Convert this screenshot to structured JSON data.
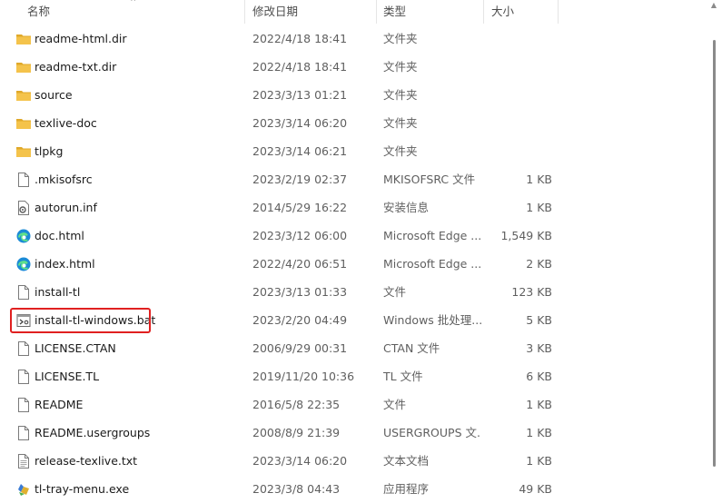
{
  "columns": {
    "name": "名称",
    "date": "修改日期",
    "type": "类型",
    "size": "大小"
  },
  "files": [
    {
      "name": "readme-html.dir",
      "date": "2022/4/18 18:41",
      "type": "文件夹",
      "size": "",
      "icon": "folder-icon"
    },
    {
      "name": "readme-txt.dir",
      "date": "2022/4/18 18:41",
      "type": "文件夹",
      "size": "",
      "icon": "folder-icon"
    },
    {
      "name": "source",
      "date": "2023/3/13 01:21",
      "type": "文件夹",
      "size": "",
      "icon": "folder-icon"
    },
    {
      "name": "texlive-doc",
      "date": "2023/3/14 06:20",
      "type": "文件夹",
      "size": "",
      "icon": "folder-icon"
    },
    {
      "name": "tlpkg",
      "date": "2023/3/14 06:21",
      "type": "文件夹",
      "size": "",
      "icon": "folder-icon"
    },
    {
      "name": ".mkisofsrc",
      "date": "2023/2/19 02:37",
      "type": "MKISOFSRC 文件",
      "size": "1 KB",
      "icon": "file-icon"
    },
    {
      "name": "autorun.inf",
      "date": "2014/5/29 16:22",
      "type": "安装信息",
      "size": "1 KB",
      "icon": "setup-info-icon"
    },
    {
      "name": "doc.html",
      "date": "2023/3/12 06:00",
      "type": "Microsoft Edge ...",
      "size": "1,549 KB",
      "icon": "edge-icon"
    },
    {
      "name": "index.html",
      "date": "2022/4/20 06:51",
      "type": "Microsoft Edge ...",
      "size": "2 KB",
      "icon": "edge-icon"
    },
    {
      "name": "install-tl",
      "date": "2023/3/13 01:33",
      "type": "文件",
      "size": "123 KB",
      "icon": "file-icon"
    },
    {
      "name": "install-tl-windows.bat",
      "date": "2023/2/20 04:49",
      "type": "Windows 批处理...",
      "size": "5 KB",
      "icon": "batch-file-icon"
    },
    {
      "name": "LICENSE.CTAN",
      "date": "2006/9/29 00:31",
      "type": "CTAN 文件",
      "size": "3 KB",
      "icon": "file-icon"
    },
    {
      "name": "LICENSE.TL",
      "date": "2019/11/20 10:36",
      "type": "TL 文件",
      "size": "6 KB",
      "icon": "file-icon"
    },
    {
      "name": "README",
      "date": "2016/5/8 22:35",
      "type": "文件",
      "size": "1 KB",
      "icon": "file-icon"
    },
    {
      "name": "README.usergroups",
      "date": "2008/8/9 21:39",
      "type": "USERGROUPS 文...",
      "size": "1 KB",
      "icon": "file-icon"
    },
    {
      "name": "release-texlive.txt",
      "date": "2023/3/14 06:20",
      "type": "文本文档",
      "size": "1 KB",
      "icon": "text-file-icon"
    },
    {
      "name": "tl-tray-menu.exe",
      "date": "2023/3/8 04:43",
      "type": "应用程序",
      "size": "49 KB",
      "icon": "exe-icon"
    }
  ],
  "colors": {
    "folder": "#f4c34b",
    "folder_dark": "#e0a92a",
    "edge": "#1b8bd6",
    "highlight": "#e02020"
  }
}
